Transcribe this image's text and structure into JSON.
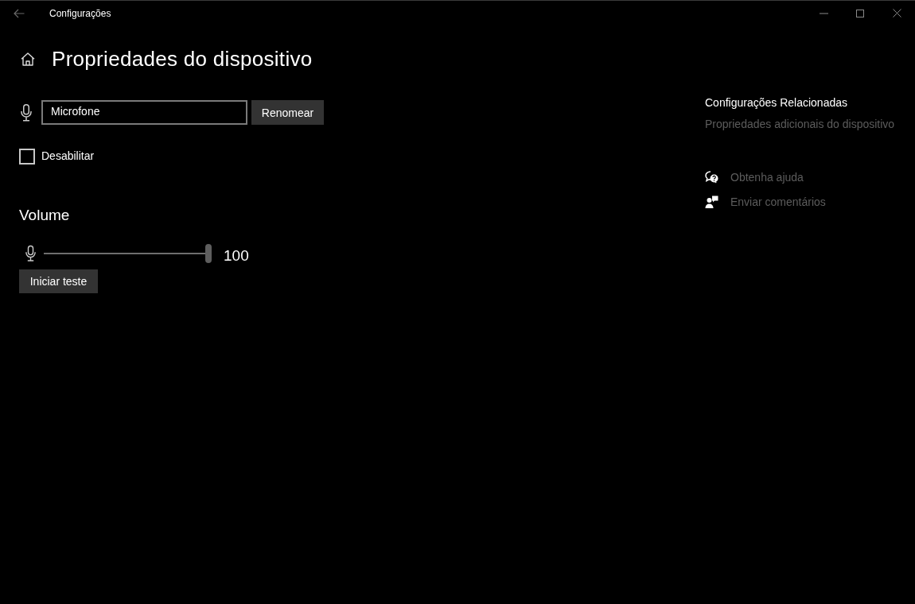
{
  "window": {
    "title": "Configurações"
  },
  "page": {
    "title": "Propriedades do dispositivo"
  },
  "device": {
    "name_field": {
      "value": "Microfone"
    },
    "rename_button": "Renomear",
    "disable": {
      "label": "Desabilitar",
      "checked": false
    }
  },
  "volume": {
    "heading": "Volume",
    "level": 1,
    "reading": "100",
    "test_button": "Iniciar teste"
  },
  "related": {
    "heading": "Configurações Relacionadas",
    "links": [
      "Propriedades adicionais do dispositivo"
    ]
  },
  "help": [
    {
      "kind": "help",
      "label": "Obtenha ajuda"
    },
    {
      "kind": "feedback",
      "label": "Enviar comentários"
    }
  ]
}
